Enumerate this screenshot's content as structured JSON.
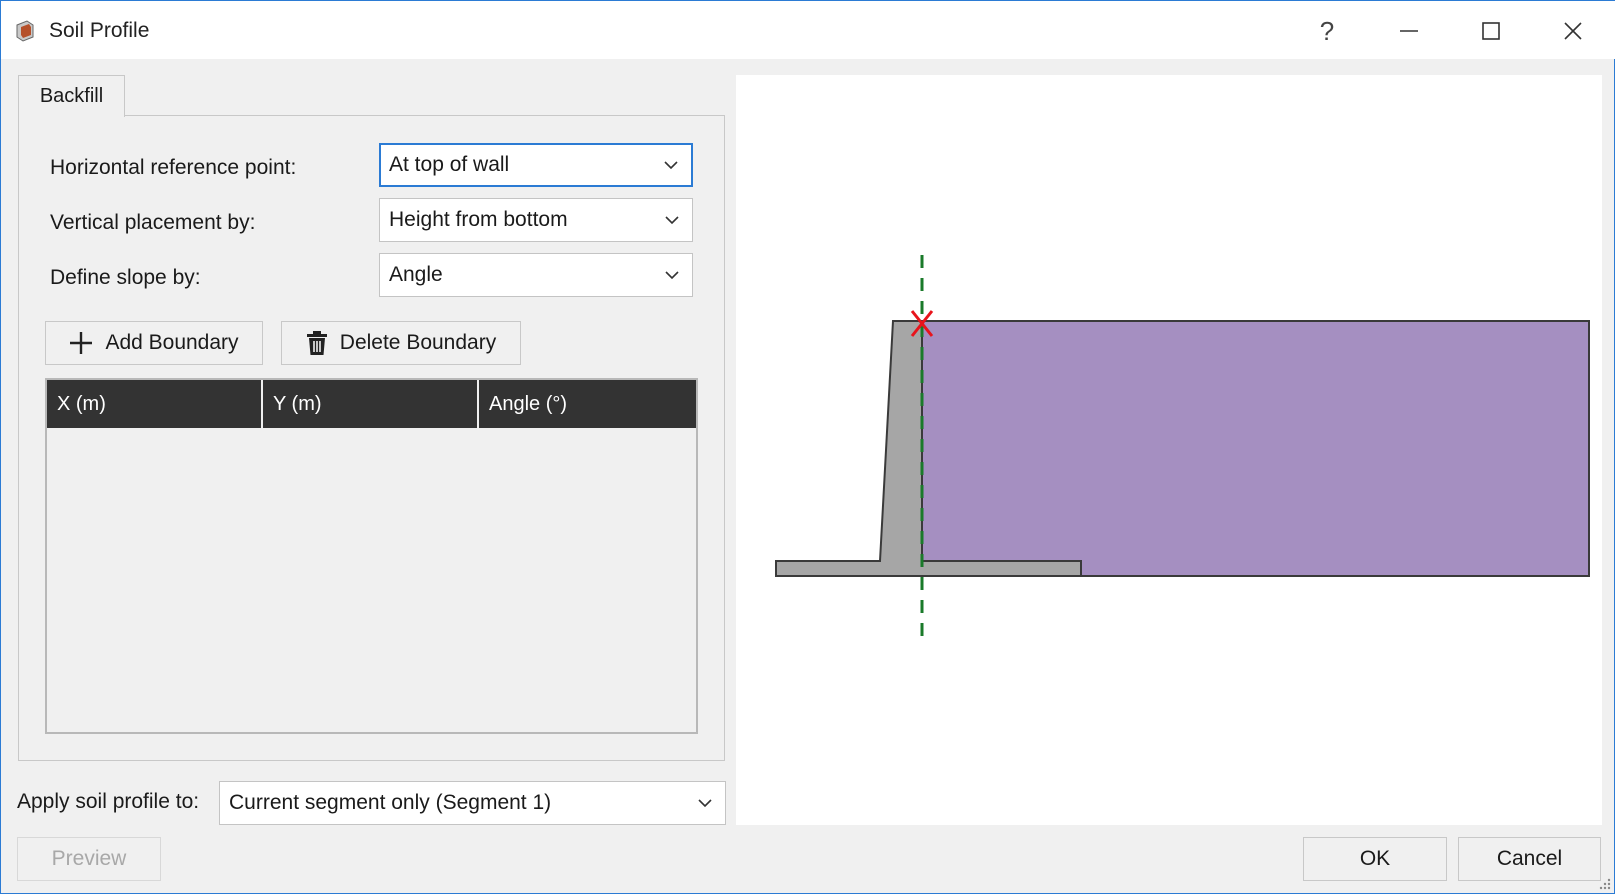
{
  "window": {
    "title": "Soil Profile",
    "help_label": "?"
  },
  "tabs": [
    {
      "label": "Backfill",
      "active": true
    }
  ],
  "form": {
    "horizontal_ref_label": "Horizontal reference point:",
    "horizontal_ref_value": "At top of wall",
    "vertical_placement_label": "Vertical placement by:",
    "vertical_placement_value": "Height from bottom",
    "slope_label": "Define slope by:",
    "slope_value": "Angle"
  },
  "buttons": {
    "add_boundary": "Add Boundary",
    "delete_boundary": "Delete Boundary",
    "preview": "Preview",
    "ok": "OK",
    "cancel": "Cancel"
  },
  "boundary_table": {
    "columns": [
      "X (m)",
      "Y (m)",
      "Angle (°)"
    ],
    "rows": []
  },
  "apply": {
    "label": "Apply soil profile to:",
    "value": "Current segment only (Segment 1)"
  },
  "colors": {
    "accent": "#2b7bd4",
    "wall_fill": "#a6a6a6",
    "soil_fill": "#a58fc1",
    "reference_line": "#1a7a2a",
    "reference_marker": "#e8141c",
    "table_header": "#333333"
  },
  "icons": [
    "app-icon",
    "help-icon",
    "minimize-icon",
    "maximize-icon",
    "close-icon",
    "chevron-down-icon",
    "plus-icon",
    "trash-icon",
    "resize-grip-icon"
  ]
}
